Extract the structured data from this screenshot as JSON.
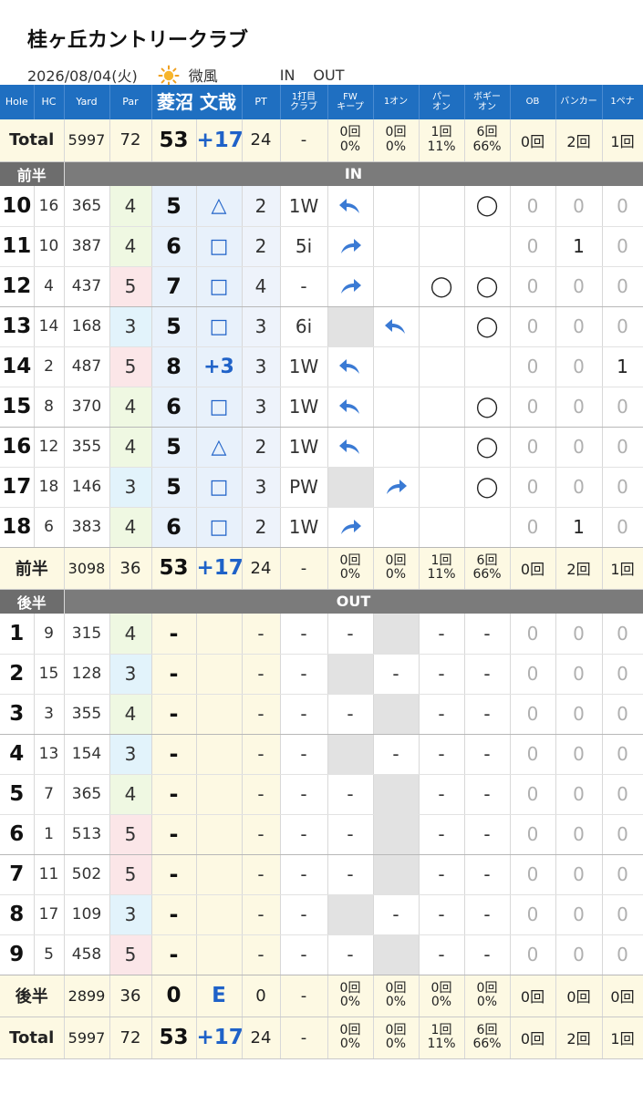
{
  "title": "桂ヶ丘カントリークラブ",
  "meta": {
    "date": "2026/08/04(火)",
    "weather_icon": "sun-icon",
    "wind": "微風",
    "tab_in": "IN",
    "tab_out": "OUT"
  },
  "colors": {
    "header": "#1f6fc1",
    "accent": "#1f62c8",
    "section": "#7b7b7b"
  },
  "headers": [
    "Hole",
    "HC",
    "Yard",
    "Par",
    "菱沼 文哉",
    "PT",
    "1打目クラブ",
    "FWキープ",
    "1オン",
    "パーオン",
    "ボギーオン",
    "OB",
    "バンカー",
    "1ペナ"
  ],
  "total_top": {
    "label": "Total",
    "yard": "5997",
    "par": "72",
    "score": "53",
    "diff": "+17",
    "pt": "24",
    "club": "-",
    "fw": [
      "0回",
      "0%"
    ],
    "on1": [
      "0回",
      "0%"
    ],
    "paron": [
      "1回",
      "11%"
    ],
    "bogeyon": [
      "6回",
      "66%"
    ],
    "ob": "0回",
    "bunker": "2回",
    "pena": "1回"
  },
  "sec1": {
    "label": "前半",
    "course": "IN"
  },
  "front": [
    {
      "hole": "10",
      "hc": "16",
      "yard": "365",
      "par": "4",
      "score": "5",
      "mark": "△",
      "pt": "2",
      "club": "1W",
      "fw": "left",
      "on1": "",
      "paron": "",
      "bogeyon": "◯",
      "ob": "0",
      "bunker": "0",
      "pena": "0"
    },
    {
      "hole": "11",
      "hc": "10",
      "yard": "387",
      "par": "4",
      "score": "6",
      "mark": "□",
      "pt": "2",
      "club": "5i",
      "fw": "right",
      "on1": "",
      "paron": "",
      "bogeyon": "",
      "ob": "0",
      "bunker": "1",
      "pena": "0"
    },
    {
      "hole": "12",
      "hc": "4",
      "yard": "437",
      "par": "5",
      "score": "7",
      "mark": "□",
      "pt": "4",
      "club": "-",
      "fw": "right",
      "on1": "",
      "paron": "◯",
      "bogeyon": "◯",
      "ob": "0",
      "bunker": "0",
      "pena": "0"
    },
    {
      "hole": "13",
      "hc": "14",
      "yard": "168",
      "par": "3",
      "score": "5",
      "mark": "□",
      "pt": "3",
      "club": "6i",
      "fw": "grey",
      "on1": "left",
      "paron": "",
      "bogeyon": "◯",
      "ob": "0",
      "bunker": "0",
      "pena": "0"
    },
    {
      "hole": "14",
      "hc": "2",
      "yard": "487",
      "par": "5",
      "score": "8",
      "mark": "+3",
      "pt": "3",
      "club": "1W",
      "fw": "left",
      "on1": "",
      "paron": "",
      "bogeyon": "",
      "ob": "0",
      "bunker": "0",
      "pena": "1"
    },
    {
      "hole": "15",
      "hc": "8",
      "yard": "370",
      "par": "4",
      "score": "6",
      "mark": "□",
      "pt": "3",
      "club": "1W",
      "fw": "left",
      "on1": "",
      "paron": "",
      "bogeyon": "◯",
      "ob": "0",
      "bunker": "0",
      "pena": "0"
    },
    {
      "hole": "16",
      "hc": "12",
      "yard": "355",
      "par": "4",
      "score": "5",
      "mark": "△",
      "pt": "2",
      "club": "1W",
      "fw": "left",
      "on1": "",
      "paron": "",
      "bogeyon": "◯",
      "ob": "0",
      "bunker": "0",
      "pena": "0"
    },
    {
      "hole": "17",
      "hc": "18",
      "yard": "146",
      "par": "3",
      "score": "5",
      "mark": "□",
      "pt": "3",
      "club": "PW",
      "fw": "grey",
      "on1": "right",
      "paron": "",
      "bogeyon": "◯",
      "ob": "0",
      "bunker": "0",
      "pena": "0"
    },
    {
      "hole": "18",
      "hc": "6",
      "yard": "383",
      "par": "4",
      "score": "6",
      "mark": "□",
      "pt": "2",
      "club": "1W",
      "fw": "right",
      "on1": "",
      "paron": "",
      "bogeyon": "",
      "ob": "0",
      "bunker": "1",
      "pena": "0"
    }
  ],
  "sub_front": {
    "label": "前半",
    "yard": "3098",
    "par": "36",
    "score": "53",
    "diff": "+17",
    "pt": "24",
    "club": "-",
    "fw": [
      "0回",
      "0%"
    ],
    "on1": [
      "0回",
      "0%"
    ],
    "paron": [
      "1回",
      "11%"
    ],
    "bogeyon": [
      "6回",
      "66%"
    ],
    "ob": "0回",
    "bunker": "2回",
    "pena": "1回"
  },
  "sec2": {
    "label": "後半",
    "course": "OUT"
  },
  "back": [
    {
      "hole": "1",
      "hc": "9",
      "yard": "315",
      "par": "4",
      "score": "-",
      "mark": "",
      "pt": "-",
      "club": "-",
      "fw": "-",
      "on1": "grey",
      "paron": "-",
      "bogeyon": "-",
      "ob": "0",
      "bunker": "0",
      "pena": "0"
    },
    {
      "hole": "2",
      "hc": "15",
      "yard": "128",
      "par": "3",
      "score": "-",
      "mark": "",
      "pt": "-",
      "club": "-",
      "fw": "grey",
      "on1": "-",
      "paron": "-",
      "bogeyon": "-",
      "ob": "0",
      "bunker": "0",
      "pena": "0"
    },
    {
      "hole": "3",
      "hc": "3",
      "yard": "355",
      "par": "4",
      "score": "-",
      "mark": "",
      "pt": "-",
      "club": "-",
      "fw": "-",
      "on1": "grey",
      "paron": "-",
      "bogeyon": "-",
      "ob": "0",
      "bunker": "0",
      "pena": "0"
    },
    {
      "hole": "4",
      "hc": "13",
      "yard": "154",
      "par": "3",
      "score": "-",
      "mark": "",
      "pt": "-",
      "club": "-",
      "fw": "grey",
      "on1": "-",
      "paron": "-",
      "bogeyon": "-",
      "ob": "0",
      "bunker": "0",
      "pena": "0"
    },
    {
      "hole": "5",
      "hc": "7",
      "yard": "365",
      "par": "4",
      "score": "-",
      "mark": "",
      "pt": "-",
      "club": "-",
      "fw": "-",
      "on1": "grey",
      "paron": "-",
      "bogeyon": "-",
      "ob": "0",
      "bunker": "0",
      "pena": "0"
    },
    {
      "hole": "6",
      "hc": "1",
      "yard": "513",
      "par": "5",
      "score": "-",
      "mark": "",
      "pt": "-",
      "club": "-",
      "fw": "-",
      "on1": "grey",
      "paron": "-",
      "bogeyon": "-",
      "ob": "0",
      "bunker": "0",
      "pena": "0"
    },
    {
      "hole": "7",
      "hc": "11",
      "yard": "502",
      "par": "5",
      "score": "-",
      "mark": "",
      "pt": "-",
      "club": "-",
      "fw": "-",
      "on1": "grey",
      "paron": "-",
      "bogeyon": "-",
      "ob": "0",
      "bunker": "0",
      "pena": "0"
    },
    {
      "hole": "8",
      "hc": "17",
      "yard": "109",
      "par": "3",
      "score": "-",
      "mark": "",
      "pt": "-",
      "club": "-",
      "fw": "grey",
      "on1": "-",
      "paron": "-",
      "bogeyon": "-",
      "ob": "0",
      "bunker": "0",
      "pena": "0"
    },
    {
      "hole": "9",
      "hc": "5",
      "yard": "458",
      "par": "5",
      "score": "-",
      "mark": "",
      "pt": "-",
      "club": "-",
      "fw": "-",
      "on1": "grey",
      "paron": "-",
      "bogeyon": "-",
      "ob": "0",
      "bunker": "0",
      "pena": "0"
    }
  ],
  "sub_back": {
    "label": "後半",
    "yard": "2899",
    "par": "36",
    "score": "0",
    "diff": "E",
    "pt": "0",
    "club": "-",
    "fw": [
      "0回",
      "0%"
    ],
    "on1": [
      "0回",
      "0%"
    ],
    "paron": [
      "0回",
      "0%"
    ],
    "bogeyon": [
      "0回",
      "0%"
    ],
    "ob": "0回",
    "bunker": "0回",
    "pena": "0回"
  },
  "total_bottom": {
    "label": "Total",
    "yard": "5997",
    "par": "72",
    "score": "53",
    "diff": "+17",
    "pt": "24",
    "club": "-",
    "fw": [
      "0回",
      "0%"
    ],
    "on1": [
      "0回",
      "0%"
    ],
    "paron": [
      "1回",
      "11%"
    ],
    "bogeyon": [
      "6回",
      "66%"
    ],
    "ob": "0回",
    "bunker": "2回",
    "pena": "1回"
  }
}
